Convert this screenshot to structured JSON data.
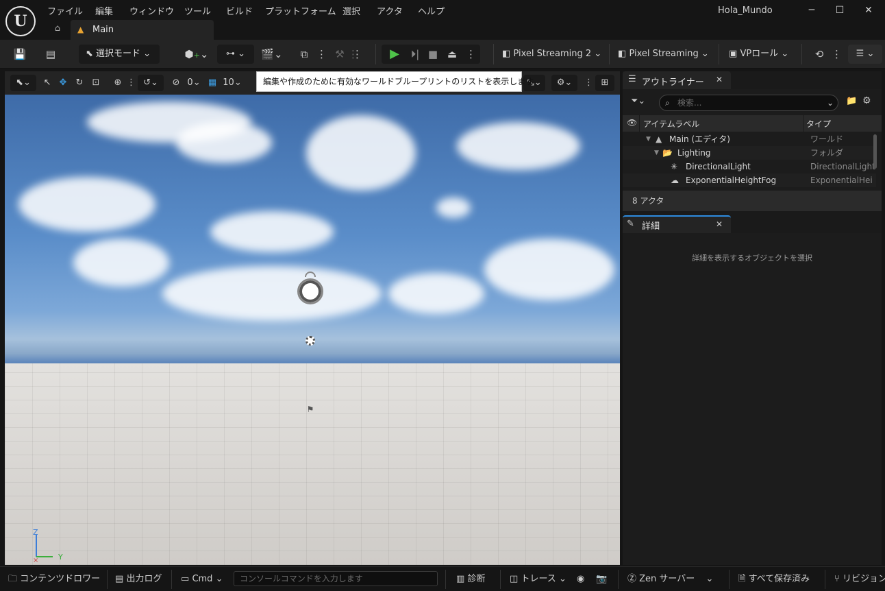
{
  "menu": [
    "ファイル",
    "編集",
    "ウィンドウ",
    "ツール",
    "ビルド",
    "プラットフォーム",
    "選択",
    "アクタ",
    "ヘルプ"
  ],
  "project_name": "Hola_Mundo",
  "tab": {
    "label": "Main"
  },
  "toolbar": {
    "select_mode": "選択モード",
    "pixel_streaming_2": "Pixel Streaming 2",
    "pixel_streaming": "Pixel Streaming",
    "vp_role": "VPロール"
  },
  "viewport": {
    "snap_rotation": "0",
    "grid_size": "10",
    "tooltip": "編集や作成のために有効なワールドブループリントのリストを表示します",
    "axis_z": "Z",
    "axis_y": "Y"
  },
  "outliner": {
    "title": "アウトライナー",
    "search_placeholder": "検索...",
    "col_label": "アイテムラベル",
    "col_type": "タイプ",
    "rows": [
      {
        "label": "Main (エディタ)",
        "type": "ワールド"
      },
      {
        "label": "Lighting",
        "type": "フォルダ"
      },
      {
        "label": "DirectionalLight",
        "type": "DirectionalLight"
      },
      {
        "label": "ExponentialHeightFog",
        "type": "ExponentialHeig"
      }
    ],
    "actor_count": "8 アクタ"
  },
  "details": {
    "title": "詳細",
    "empty_message": "詳細を表示するオブジェクトを選択"
  },
  "statusbar": {
    "content_drawer": "コンテンツドロワー",
    "output_log": "出力ログ",
    "cmd": "Cmd",
    "console_placeholder": "コンソールコマンドを入力します",
    "diagnostics": "診断",
    "trace": "トレース",
    "zen_server": "Zen サーバー",
    "save_all": "すべて保存済み",
    "revision": "リビジョン"
  },
  "colors": {
    "play_green": "#4fc34a",
    "tab_accent": "#e8a332",
    "selection_blue": "#2d8ce0"
  }
}
